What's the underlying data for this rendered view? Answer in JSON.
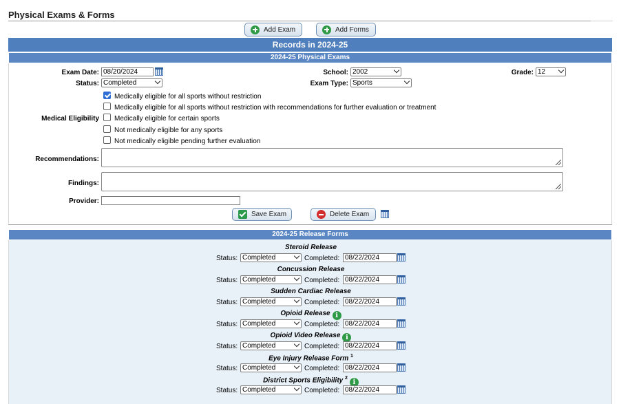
{
  "page": {
    "title": "Physical Exams & Forms"
  },
  "toolbar": {
    "add_exam": "Add Exam",
    "add_forms": "Add Forms"
  },
  "records_header": "Records in 2024-25",
  "exam_section": {
    "header": "2024-25 Physical Exams",
    "exam_date_label": "Exam Date:",
    "exam_date": "08/20/2024",
    "school_label": "School:",
    "school": "2002",
    "grade_label": "Grade:",
    "grade": "12",
    "status_label": "Status:",
    "status": "Completed",
    "exam_type_label": "Exam Type:",
    "exam_type": "Sports",
    "medical_eligibility_label": "Medical Eligibility",
    "eligibility_options": [
      {
        "label": "Medically eligible for all sports without restriction",
        "checked": true
      },
      {
        "label": "Medically eligible for all sports without restriction with recommendations for further evaluation or treatment",
        "checked": false
      },
      {
        "label": "Medically eligible for certain sports",
        "checked": false
      },
      {
        "label": "Not medically eligible for any sports",
        "checked": false
      },
      {
        "label": "Not medically eligible pending further evaluation",
        "checked": false
      }
    ],
    "recommendations_label": "Recommendations:",
    "findings_label": "Findings:",
    "provider_label": "Provider:",
    "save_exam": "Save Exam",
    "delete_exam": "Delete Exam"
  },
  "release_section": {
    "header": "2024-25 Release Forms",
    "status_label": "Status:",
    "completed_label": "Completed:",
    "forms": [
      {
        "title": "Steroid Release",
        "status": "Completed",
        "date": "08/22/2024",
        "info": false,
        "note": ""
      },
      {
        "title": "Concussion Release",
        "status": "Completed",
        "date": "08/22/2024",
        "info": false,
        "note": ""
      },
      {
        "title": "Sudden Cardiac Release",
        "status": "Completed",
        "date": "08/22/2024",
        "info": false,
        "note": ""
      },
      {
        "title": "Opioid Release",
        "status": "Completed",
        "date": "08/22/2024",
        "info": true,
        "note": ""
      },
      {
        "title": "Opioid Video Release",
        "status": "Completed",
        "date": "08/22/2024",
        "info": true,
        "note": ""
      },
      {
        "title": "Eye Injury Release Form",
        "status": "Completed",
        "date": "08/22/2024",
        "info": false,
        "note": "1"
      },
      {
        "title": "District Sports Eligibility",
        "status": "Completed",
        "date": "08/22/2024",
        "info": true,
        "note": "2"
      }
    ]
  }
}
